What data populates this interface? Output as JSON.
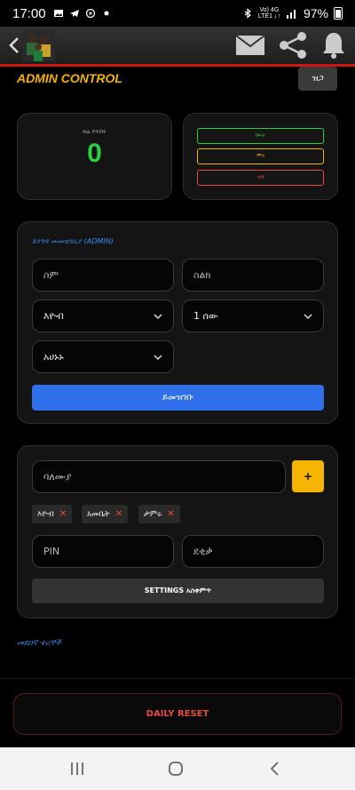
{
  "status_bar": {
    "time": "17:00",
    "network_top": "Vo) 4G",
    "network_bottom": "LTE1 ↓↑",
    "battery": "97%"
  },
  "header": {
    "title": "ADMIN CONTROL",
    "close_label": "ዝጋ"
  },
  "counter": {
    "label": "ዛሬ የተሰሩ",
    "value": "0"
  },
  "filters": [
    {
      "label": "ክፍት",
      "color": "#2ecc40"
    },
    {
      "label": "ሞላ",
      "color": "#f4b400"
    },
    {
      "label": "ዝግ",
      "color": "#e74c3c"
    }
  ],
  "guest_form": {
    "title": "እንግዳ መመዝገቢያ (ADMIN)",
    "name_placeholder": "ስም",
    "phone_placeholder": "ስልክ",
    "select_1": "እዮብ",
    "select_2": "1 ሰው",
    "select_3": "አሀኑኑ",
    "submit_label": "ይመዝገቡ"
  },
  "settings": {
    "owner_placeholder": "ባለሙያ",
    "add_label": "+",
    "chips": [
      "እዮብ",
      "አመቤት",
      "ታምሩ"
    ],
    "chip_remove": "✕",
    "pin_placeholder": "PIN",
    "minutes_placeholder": "ደቂቃ",
    "save_label": "SETTINGS አስቀምጥ"
  },
  "records_link": "መደበኛ ተረኞች",
  "reset_label": "DAILY RESET",
  "colors": {
    "accent_yellow": "#f4b400",
    "accent_blue": "#2f6fea",
    "accent_red": "#d01414",
    "success": "#2ecc40"
  }
}
